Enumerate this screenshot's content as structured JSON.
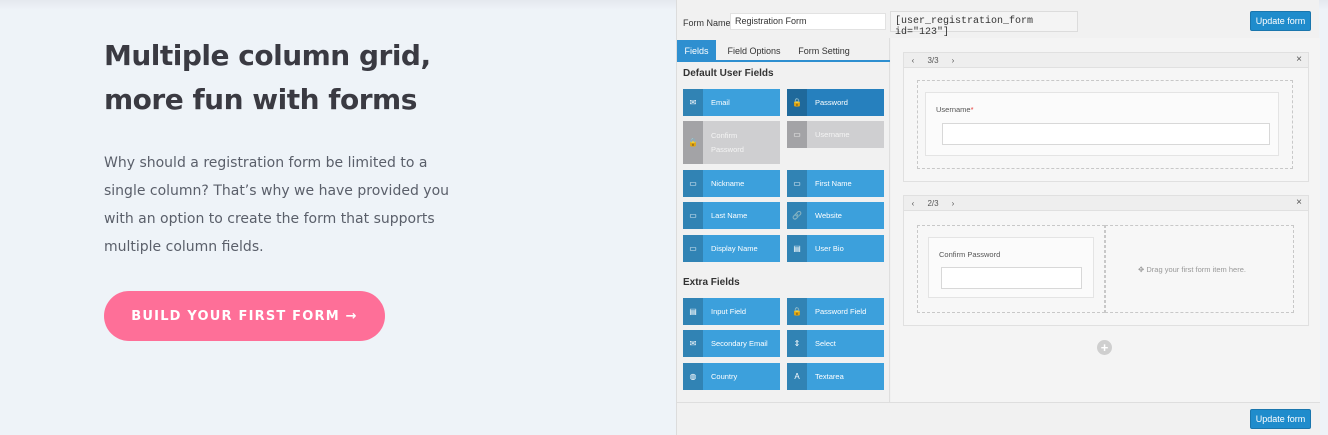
{
  "hero": {
    "title_line1": "Multiple column grid,",
    "title_line2": "more fun with forms",
    "description": "Why should a registration form be limited to a single column? That’s why we have provided you with an option to create the form that supports multiple column fields.",
    "cta_label": "BUILD YOUR FIRST FORM →"
  },
  "builder": {
    "form_name_label": "Form Name",
    "form_name_value": "Registration Form",
    "shortcode": "[user_registration_form id=\"123\"]",
    "update_label": "Update form",
    "tabs": [
      "Fields",
      "Field Options",
      "Form Setting"
    ],
    "default_section_title": "Default User Fields",
    "default_fields": [
      {
        "label": "Email",
        "icon": "✉"
      },
      {
        "label": "Password",
        "icon": "🔒"
      },
      {
        "label": "Confirm Password",
        "icon": "🔒"
      },
      {
        "label": "Username",
        "icon": "▭"
      },
      {
        "label": "Nickname",
        "icon": "▭"
      },
      {
        "label": "First Name",
        "icon": "▭"
      },
      {
        "label": "Last Name",
        "icon": "▭"
      },
      {
        "label": "Website",
        "icon": "🔗"
      },
      {
        "label": "Display Name",
        "icon": "▭"
      },
      {
        "label": "User Bio",
        "icon": "▤"
      }
    ],
    "extra_section_title": "Extra Fields",
    "extra_fields": [
      {
        "label": "Input Field",
        "icon": "▤"
      },
      {
        "label": "Password Field",
        "icon": "🔒"
      },
      {
        "label": "Secondary Email",
        "icon": "✉"
      },
      {
        "label": "Select",
        "icon": "⇕"
      },
      {
        "label": "Country",
        "icon": "◍"
      },
      {
        "label": "Textarea",
        "icon": "A"
      }
    ],
    "rows": [
      {
        "columns": "3/3",
        "field_label": "Username",
        "required_mark": "*"
      },
      {
        "columns": "2/3",
        "field_label": "Confirm Password",
        "drop_hint": "✥ Drag your first form item here."
      }
    ],
    "nav_prev": "‹",
    "nav_next": "›",
    "close": "×",
    "add_row": "+",
    "colors": {
      "accent": "#3ca0dc",
      "cta": "#fe6f98",
      "tab_active": "#2e8fd0"
    }
  }
}
